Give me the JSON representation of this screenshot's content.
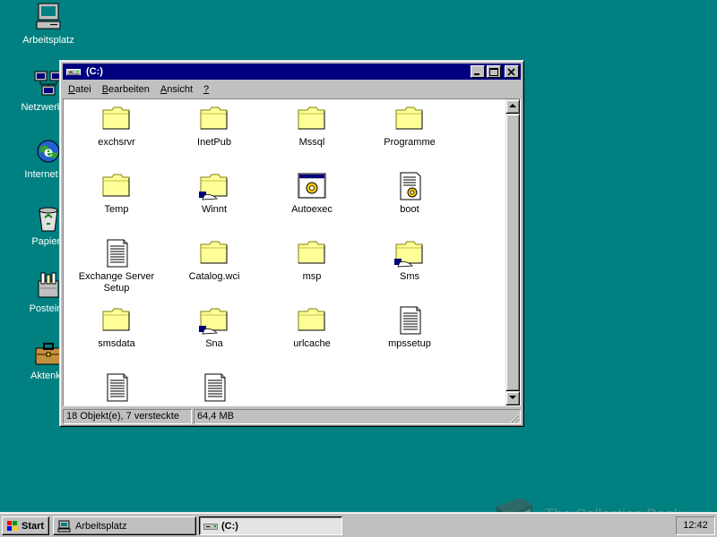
{
  "desktop": {
    "icons": [
      {
        "label": "Arbeitsplatz",
        "icon": "my-computer-icon"
      },
      {
        "label": "Netzwerkum",
        "icon": "network-icon"
      },
      {
        "label": "Internet Ex",
        "icon": "internet-explorer-icon"
      },
      {
        "label": "Papierk",
        "icon": "recycle-bin-icon"
      },
      {
        "label": "Posteing",
        "icon": "inbox-icon"
      },
      {
        "label": "Aktenko",
        "icon": "briefcase-icon"
      }
    ]
  },
  "window": {
    "title": "(C:)",
    "menu": [
      {
        "label": "Datei",
        "accel_index": 0
      },
      {
        "label": "Bearbeiten",
        "accel_index": 0
      },
      {
        "label": "Ansicht",
        "accel_index": 0
      },
      {
        "label": "?",
        "accel_index": 0
      }
    ],
    "items": [
      {
        "label": "exchsrvr",
        "type": "folder"
      },
      {
        "label": "InetPub",
        "type": "folder"
      },
      {
        "label": "Mssql",
        "type": "folder"
      },
      {
        "label": "Programme",
        "type": "folder"
      },
      {
        "label": "Temp",
        "type": "folder"
      },
      {
        "label": "Winnt",
        "type": "shared-folder"
      },
      {
        "label": "Autoexec",
        "type": "batch-file"
      },
      {
        "label": "boot",
        "type": "settings-file"
      },
      {
        "label": "Exchange Server Setup",
        "type": "text-file"
      },
      {
        "label": "Catalog.wci",
        "type": "folder"
      },
      {
        "label": "msp",
        "type": "folder"
      },
      {
        "label": "Sms",
        "type": "shared-folder"
      },
      {
        "label": "smsdata",
        "type": "folder"
      },
      {
        "label": "Sna",
        "type": "shared-folder"
      },
      {
        "label": "urlcache",
        "type": "folder"
      },
      {
        "label": "mpssetup",
        "type": "text-file"
      },
      {
        "label": "",
        "type": "text-file"
      },
      {
        "label": "",
        "type": "text-file"
      }
    ],
    "status": {
      "objects": "18 Objekt(e), 7 versteckte",
      "size": "64,4 MB"
    }
  },
  "taskbar": {
    "start_label": "Start",
    "tasks": [
      {
        "label": "Arbeitsplatz",
        "active": false
      },
      {
        "label": "(C:)",
        "active": true
      }
    ],
    "clock": "12:42"
  },
  "watermark": {
    "text": "The Collection Book"
  },
  "colors": {
    "desktop": "#008080",
    "titlebar": "#000080",
    "face": "#c0c0c0",
    "folder": "#ffff99"
  }
}
